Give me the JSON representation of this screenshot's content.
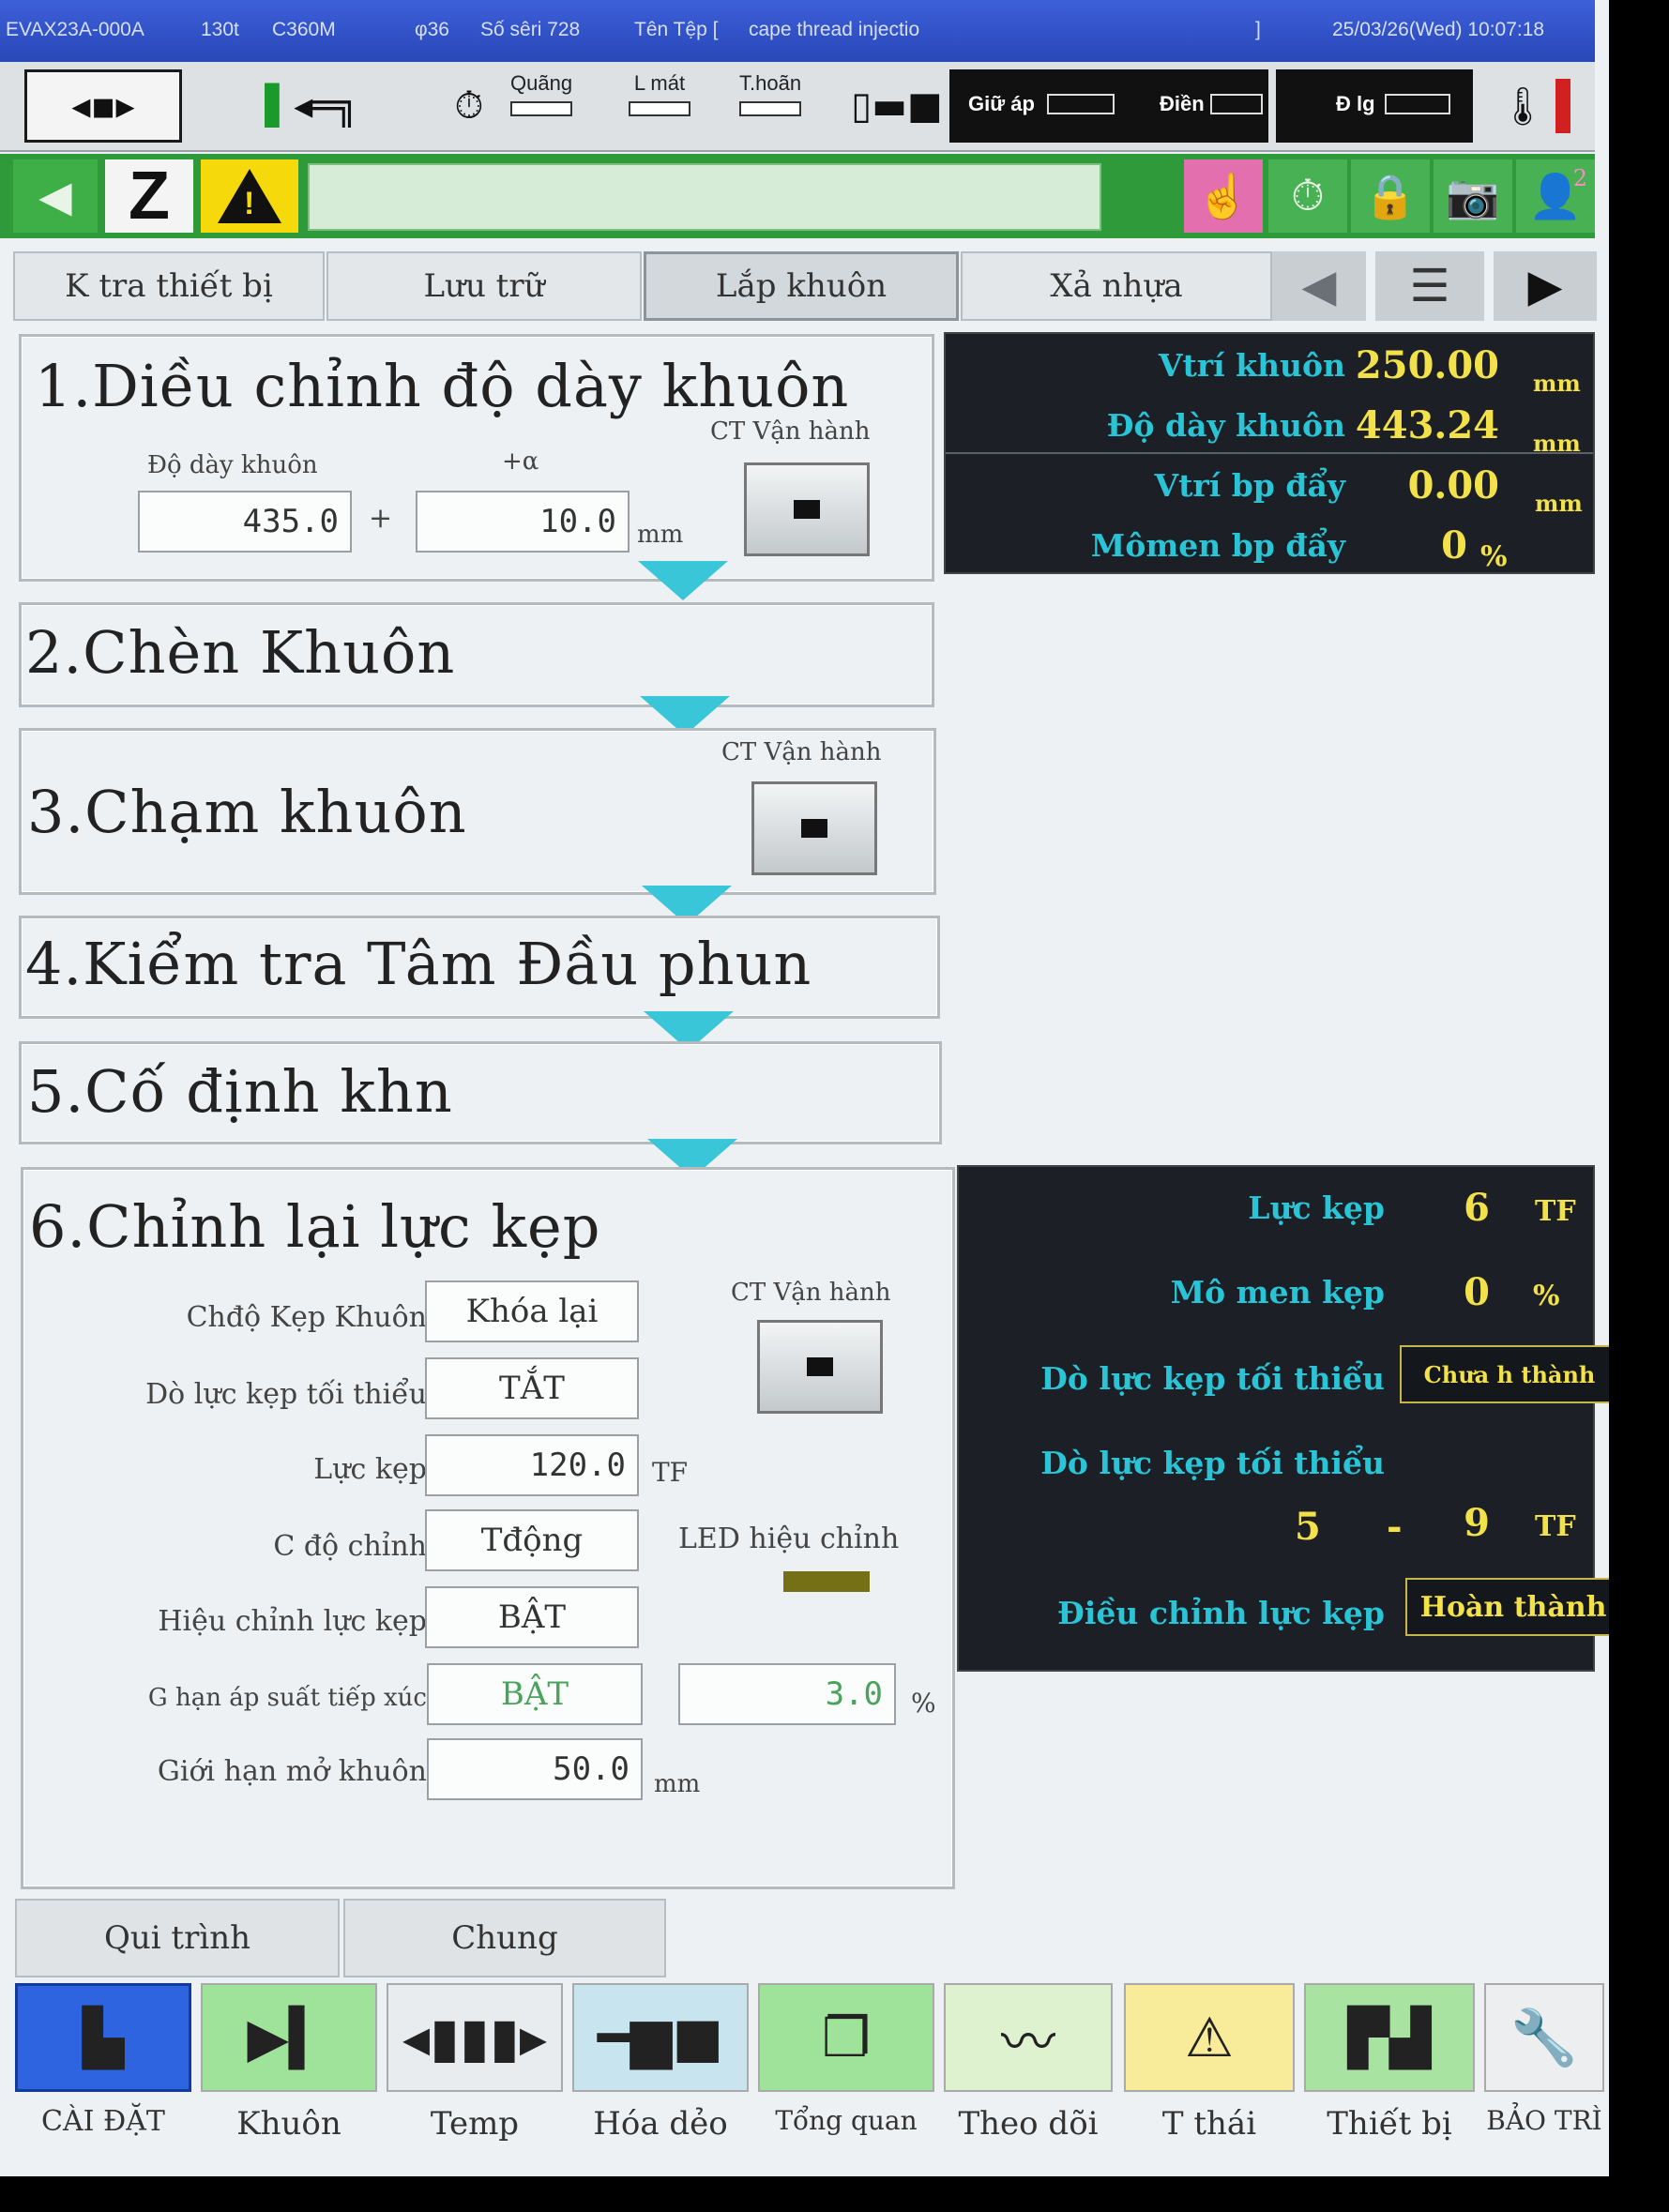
{
  "status": {
    "model": "EVAX23A-000A",
    "tonnage": "130t",
    "controller": "C360M",
    "screw": "φ36",
    "serial": "Số sêri  728",
    "file_label": "Tên Tệp [",
    "file_name": "cape thread injectio",
    "file_end": "]",
    "datetime": "25/03/26(Wed)  10:07:18"
  },
  "toolbar": {
    "stroke_label": "Quãng",
    "cooling_label": "L mát",
    "hold_label": "T.hoãn",
    "holding_label": "Giữ áp",
    "filling_label": "Điền",
    "metering_label": "Đ lg"
  },
  "greenbar": {
    "alert_icon": "!",
    "badge": "2"
  },
  "tabs": [
    "K tra thiết bị",
    "Lưu trữ",
    "Lắp khuôn",
    "Xả nhựa"
  ],
  "steps": {
    "s1": {
      "title": "1.Diều chỉnh độ dày khuôn",
      "thickness_label": "Độ dày khuôn",
      "alpha_label": "+α",
      "thickness_value": "435.0",
      "plus": "+",
      "alpha_value": "10.0",
      "unit": "mm",
      "op_label": "CT Vận hành"
    },
    "s2": {
      "title": "2.Chèn Khuôn"
    },
    "s3": {
      "title": "3.Chạm khuôn",
      "op_label": "CT Vận hành"
    },
    "s4": {
      "title": "4.Kiểm tra Tâm Đầu phun"
    },
    "s5": {
      "title": "5.Cố định khn"
    },
    "s6": {
      "title": "6.Chỉnh lại lực kẹp",
      "op_label": "CT Vận hành",
      "rows": [
        {
          "label": "Chđộ Kẹp Khuôn",
          "value": "Khóa lại"
        },
        {
          "label": "Dò lực kẹp tối thiểu",
          "value": "TẮT"
        },
        {
          "label": "Lực kẹp",
          "value": "120.0",
          "unit": "TF"
        },
        {
          "label": "C độ chỉnh",
          "value": "Tđộng"
        },
        {
          "label": "Hiệu chỉnh lực kẹp",
          "value": "BẬT"
        },
        {
          "label": "G hạn áp suất tiếp xúc",
          "value": "BẬT",
          "extra": "3.0",
          "unit": "%"
        },
        {
          "label": "Giới hạn mở khuôn",
          "value": "50.0",
          "unit": "mm"
        }
      ],
      "led_label": "LED hiệu chỉnh"
    }
  },
  "info_top": [
    {
      "label": "Vtrí khuôn",
      "value": "250.00",
      "unit": "mm"
    },
    {
      "label": "Độ dày khuôn",
      "value": "443.24",
      "unit": "mm"
    },
    {
      "label": "Vtrí bp đẩy",
      "value": "0.00",
      "unit": "mm"
    },
    {
      "label": "Mômen bp đẩy",
      "value": "0",
      "unit": "%"
    }
  ],
  "info_bottom": {
    "clamp_label": "Lực kẹp",
    "clamp_value": "6",
    "clamp_unit": "TF",
    "torque_label": "Mô men kẹp",
    "torque_value": "0",
    "torque_unit": "%",
    "min_search_label": "Dò lực kẹp tối thiểu",
    "min_search_status": "Chưa h thành",
    "min_range_label": "Dò lực kẹp tối thiểu",
    "range_low": "5",
    "range_dash": "-",
    "range_high": "9",
    "range_unit": "TF",
    "adjust_label": "Điều chỉnh lực kẹp",
    "adjust_status": "Hoàn thành"
  },
  "subtabs": [
    "Qui trình",
    "Chung"
  ],
  "bottom_nav": [
    "CÀI ĐẶT",
    "Khuôn",
    "Temp",
    "Hóa dẻo",
    "Tổng quan",
    "Theo dõi",
    "T thái",
    "Thiết bị",
    "BẢO TRÌ"
  ]
}
